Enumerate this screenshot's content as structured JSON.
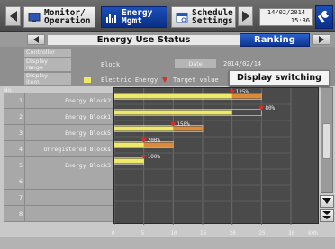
{
  "nav": {
    "monitor_label_1": "Monitor/",
    "monitor_label_2": "Operation",
    "energy_label_1": "Energy",
    "energy_label_2": "Mgmt",
    "schedule_label_1": "Schedule",
    "schedule_label_2": "Settings",
    "date": "14/02/2014",
    "time": "15:36"
  },
  "subbar": {
    "title": "Energy Use Status",
    "tab": "Ranking"
  },
  "info": {
    "controller_label": "Controller",
    "range_label_1": "Display",
    "range_label_2": "range",
    "range_value": "Block",
    "date_label": "Date",
    "date_value": "2014/02/14",
    "item_label_1": "Display",
    "item_label_2": "item",
    "legend_energy": "Electric Energy",
    "legend_target": "Target value",
    "display_switching": "Display switching"
  },
  "list": {
    "no_label": "No.",
    "rows": [
      {
        "num": "1",
        "name": "Energy Block2"
      },
      {
        "num": "2",
        "name": "Energy Block1"
      },
      {
        "num": "3",
        "name": "Energy Block5"
      },
      {
        "num": "4",
        "name": "Unregistered Blocks"
      },
      {
        "num": "5",
        "name": "Energy Block3"
      },
      {
        "num": "6",
        "name": ""
      },
      {
        "num": "7",
        "name": ""
      },
      {
        "num": "8",
        "name": ""
      }
    ]
  },
  "chart_data": {
    "type": "bar",
    "orientation": "horizontal",
    "categories": [
      "Energy Block2",
      "Energy Block1",
      "Energy Block5",
      "Unregistered Blocks",
      "Energy Block3"
    ],
    "series": [
      {
        "name": "Electric Energy",
        "values": [
          25,
          20,
          15,
          10,
          5
        ]
      },
      {
        "name": "Target value",
        "values": [
          20,
          25,
          10,
          5,
          5
        ]
      }
    ],
    "data_labels": [
      "125%",
      "80%",
      "150%",
      "200%",
      "100%"
    ],
    "x_ticks": [
      "0",
      "5",
      "10",
      "15",
      "20",
      "25",
      "30"
    ],
    "xlim": [
      0,
      30
    ],
    "unit": "kWh",
    "grid": true,
    "colors": {
      "energy": "#eee96b",
      "target_line": "#d98a3a",
      "target_marker": "#d6302a"
    }
  }
}
